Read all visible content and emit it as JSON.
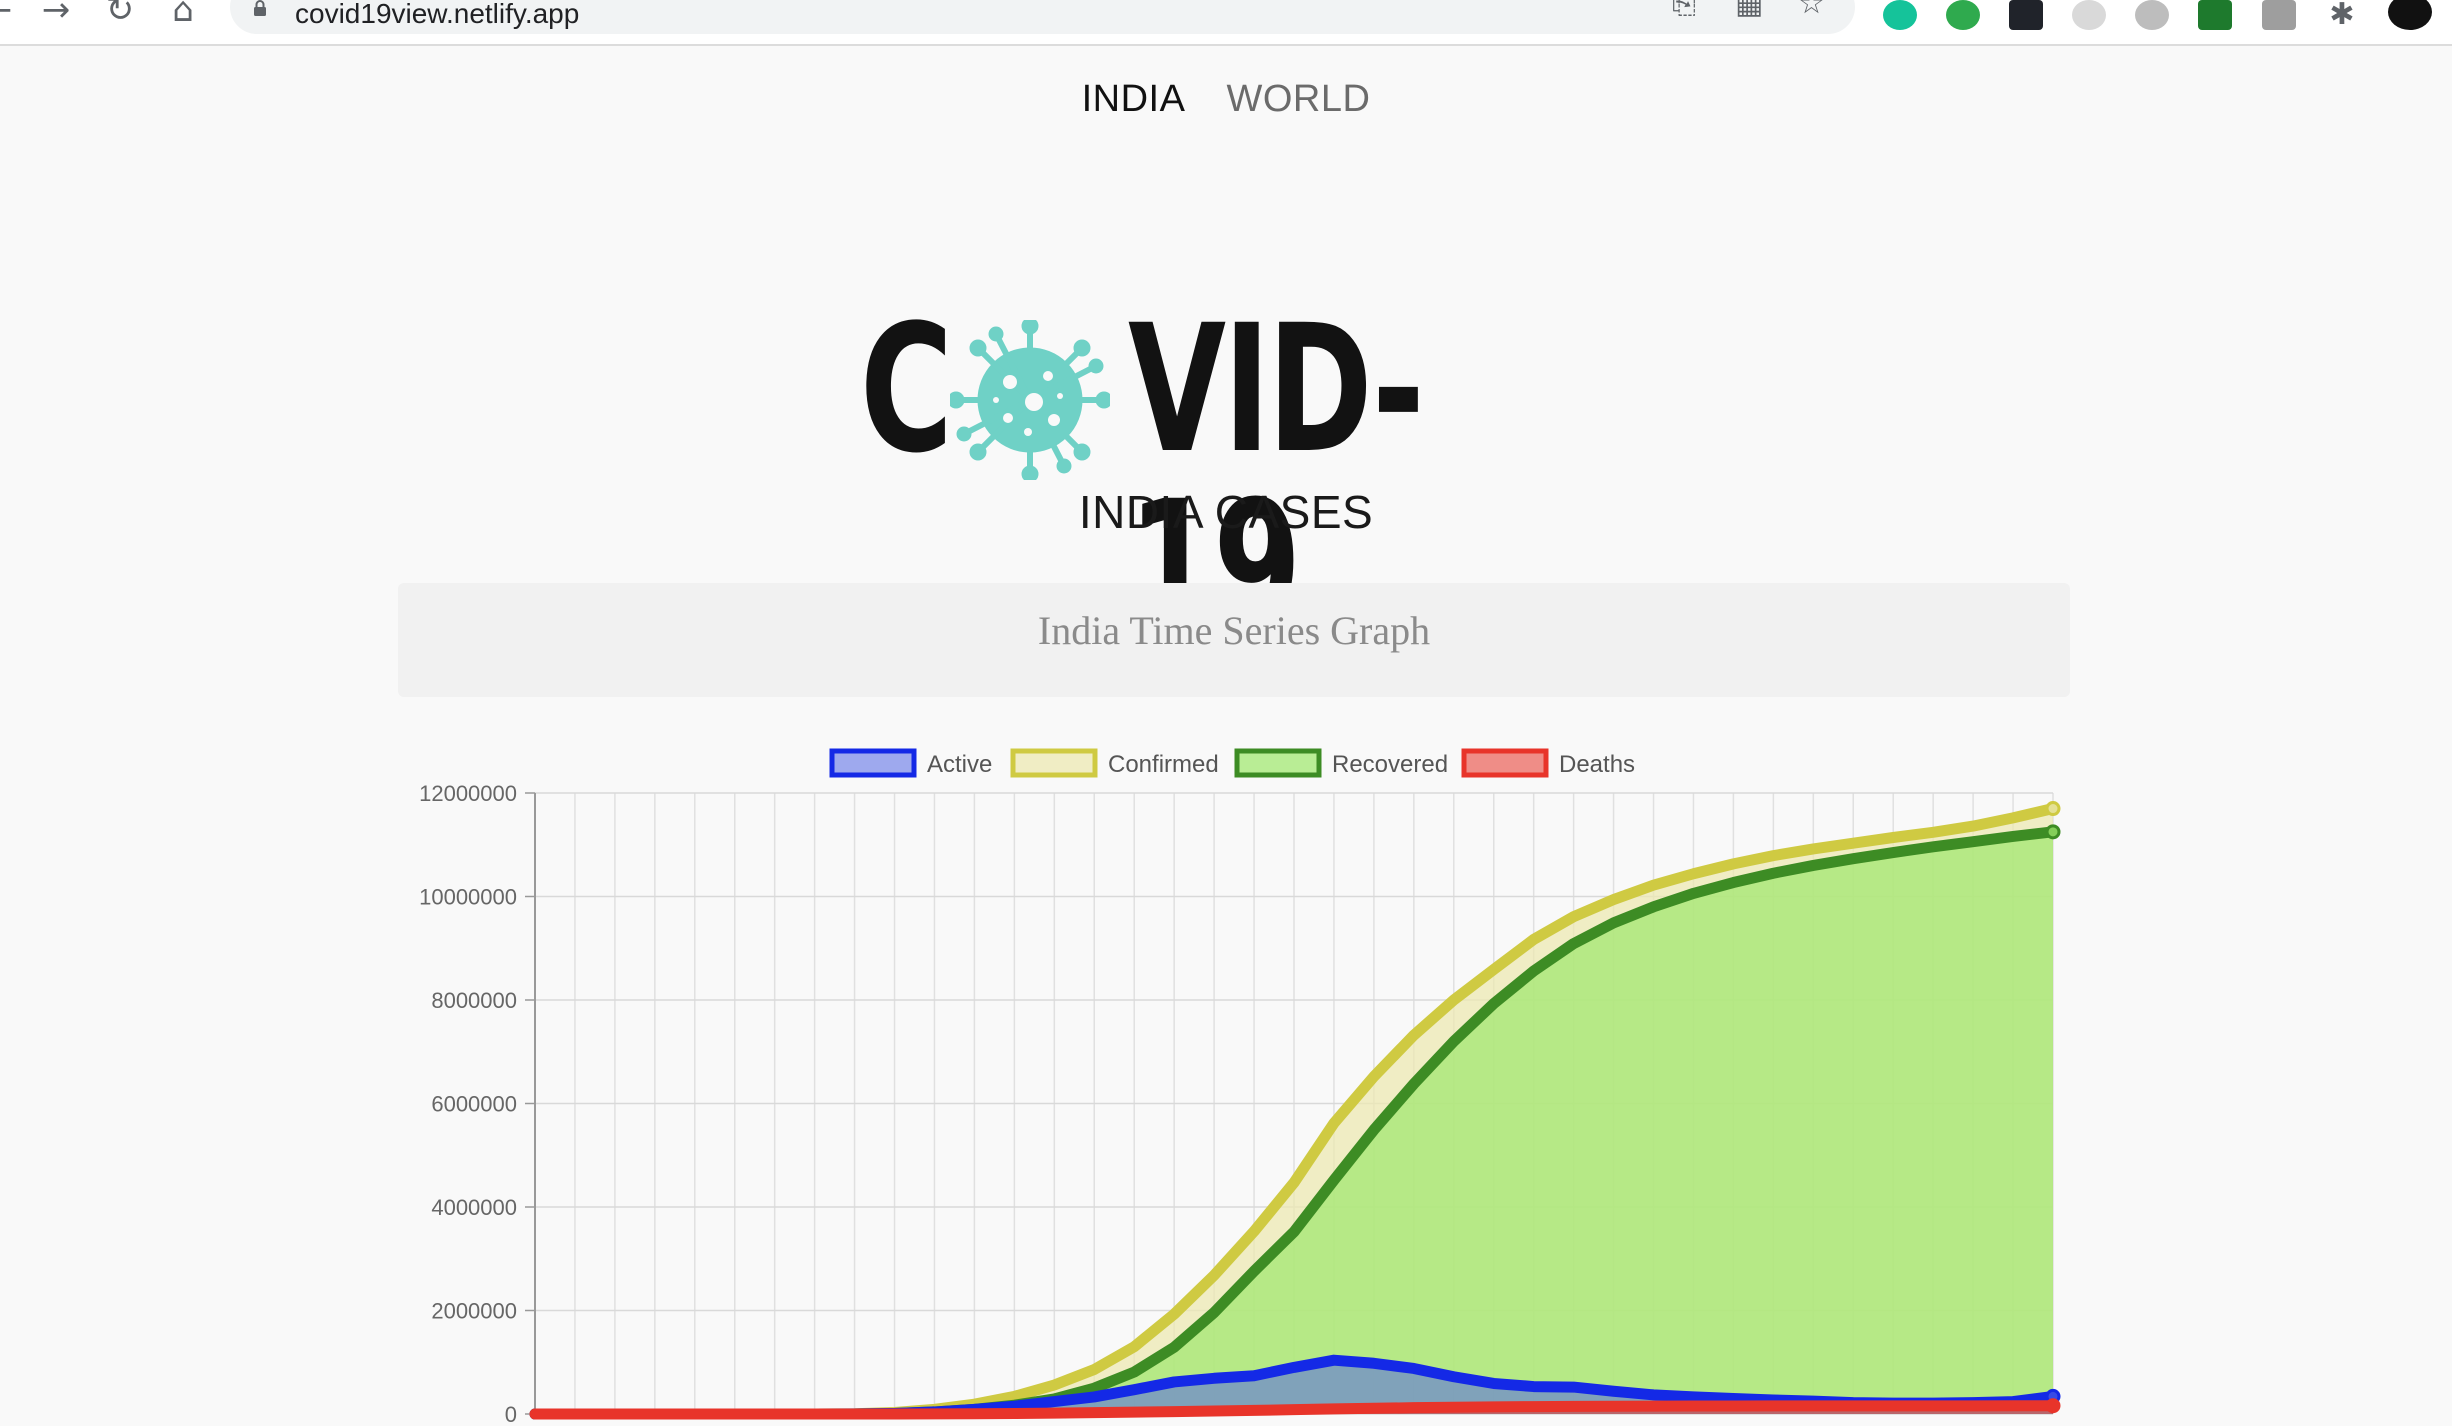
{
  "browser": {
    "url": "covid19view.netlify.app"
  },
  "nav": {
    "items": [
      {
        "label": "INDIA",
        "active": true
      },
      {
        "label": "WORLD",
        "active": false
      }
    ]
  },
  "logo": {
    "text_left": "C",
    "text_right": "VID-19",
    "virus_color": "#6fd1c6"
  },
  "page": {
    "subtitle": "INDIA CASES",
    "graph_title": "India Time Series Graph"
  },
  "chart_data": {
    "type": "area",
    "title": "",
    "xlabel": "",
    "ylabel": "",
    "ylim": [
      0,
      12000000
    ],
    "y_ticks": [
      "0",
      "2000000",
      "4000000",
      "6000000",
      "8000000",
      "10000000",
      "12000000"
    ],
    "grid": true,
    "legend_position": "top",
    "x": [
      0,
      1,
      2,
      3,
      4,
      5,
      6,
      7,
      8,
      9,
      10,
      11,
      12,
      13,
      14,
      15,
      16,
      17,
      18,
      19,
      20,
      21,
      22,
      23,
      24,
      25,
      26,
      27,
      28,
      29,
      30,
      31,
      32,
      33,
      34,
      35,
      36,
      37,
      38
    ],
    "series": [
      {
        "name": "Active",
        "border": "#1429e6",
        "fill": "rgba(83,104,230,0.55)",
        "values": [
          0,
          0,
          0,
          0,
          0,
          0,
          0,
          0,
          2000,
          10000,
          40000,
          90000,
          150000,
          240000,
          330000,
          470000,
          620000,
          690000,
          740000,
          900000,
          1040000,
          980000,
          880000,
          720000,
          590000,
          530000,
          520000,
          440000,
          370000,
          330000,
          300000,
          270000,
          250000,
          220000,
          210000,
          210000,
          220000,
          240000,
          340000
        ]
      },
      {
        "name": "Confirmed",
        "border": "#cfca42",
        "fill": "rgba(236,232,178,0.75)",
        "values": [
          0,
          0,
          0,
          0,
          0,
          0,
          0,
          0,
          5000,
          30000,
          90000,
          190000,
          340000,
          560000,
          860000,
          1300000,
          1930000,
          2680000,
          3530000,
          4470000,
          5620000,
          6520000,
          7320000,
          8000000,
          8590000,
          9170000,
          9610000,
          9940000,
          10220000,
          10440000,
          10630000,
          10790000,
          10920000,
          11030000,
          11140000,
          11240000,
          11360000,
          11520000,
          11700000
        ]
      },
      {
        "name": "Recovered",
        "border": "#3d8c24",
        "fill": "rgba(160,232,110,0.72)",
        "values": [
          0,
          0,
          0,
          0,
          0,
          0,
          0,
          0,
          0,
          10000,
          40000,
          90000,
          170000,
          290000,
          500000,
          810000,
          1290000,
          1960000,
          2760000,
          3520000,
          4520000,
          5490000,
          6380000,
          7200000,
          7930000,
          8560000,
          9090000,
          9490000,
          9800000,
          10060000,
          10270000,
          10450000,
          10600000,
          10730000,
          10850000,
          10960000,
          11060000,
          11160000,
          11250000
        ]
      },
      {
        "name": "Deaths",
        "border": "#e8342a",
        "fill": "rgba(232,52,42,0.55)",
        "values": [
          0,
          0,
          0,
          0,
          0,
          0,
          0,
          0,
          0,
          1000,
          3000,
          6000,
          10000,
          17000,
          26000,
          36000,
          47000,
          58000,
          70000,
          84000,
          100000,
          110000,
          122000,
          131000,
          138000,
          143000,
          147000,
          150000,
          152000,
          154000,
          155000,
          156000,
          156000,
          157000,
          157000,
          158000,
          158000,
          159000,
          160000
        ]
      }
    ]
  }
}
